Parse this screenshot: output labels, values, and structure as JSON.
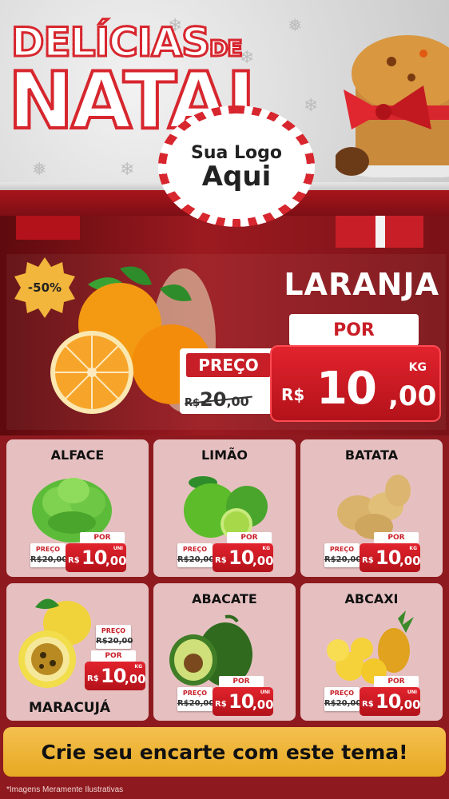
{
  "header": {
    "title_line1": "DELÍCIAS",
    "title_de": "DE",
    "title_line2": "NATAL",
    "logo_line1": "Sua Logo",
    "logo_line2": "Aqui"
  },
  "hero": {
    "discount": "-50%",
    "product": "LARANJA",
    "por_label": "POR",
    "preco_label": "PREÇO",
    "old_currency": "R$",
    "old_value": "20",
    "old_cents": ",00",
    "currency": "R$",
    "value": "10",
    "cents": ",00",
    "unit": "KG"
  },
  "cards": [
    {
      "name": "ALFACE",
      "preco_label": "PREÇO",
      "old": "R$20,00",
      "por_label": "POR",
      "currency": "R$",
      "value": "10",
      "cents": ",00",
      "unit": "UNI"
    },
    {
      "name": "LIMÃO",
      "preco_label": "PREÇO",
      "old": "R$20,00",
      "por_label": "POR",
      "currency": "R$",
      "value": "10",
      "cents": ",00",
      "unit": "KG"
    },
    {
      "name": "BATATA",
      "preco_label": "PREÇO",
      "old": "R$20,00",
      "por_label": "POR",
      "currency": "R$",
      "value": "10",
      "cents": ",00",
      "unit": "KG"
    },
    {
      "name": "MARACUJÁ",
      "preco_label": "PREÇO",
      "old": "R$20,00",
      "por_label": "POR",
      "currency": "R$",
      "value": "10",
      "cents": ",00",
      "unit": "KG"
    },
    {
      "name": "ABACATE",
      "preco_label": "PREÇO",
      "old": "R$20,00",
      "por_label": "POR",
      "currency": "R$",
      "value": "10",
      "cents": ",00",
      "unit": "UNI"
    },
    {
      "name": "ABCAXI",
      "preco_label": "PREÇO",
      "old": "R$20,00",
      "por_label": "POR",
      "currency": "R$",
      "value": "10",
      "cents": ",00",
      "unit": "UNI"
    }
  ],
  "cta": "Crie seu encarte com este tema!",
  "disclaimer": "*Imagens Meramente Ilustrativas",
  "colors": {
    "red": "#c81e27",
    "dark_red": "#8e1a1f",
    "gold": "#f5c04f"
  }
}
